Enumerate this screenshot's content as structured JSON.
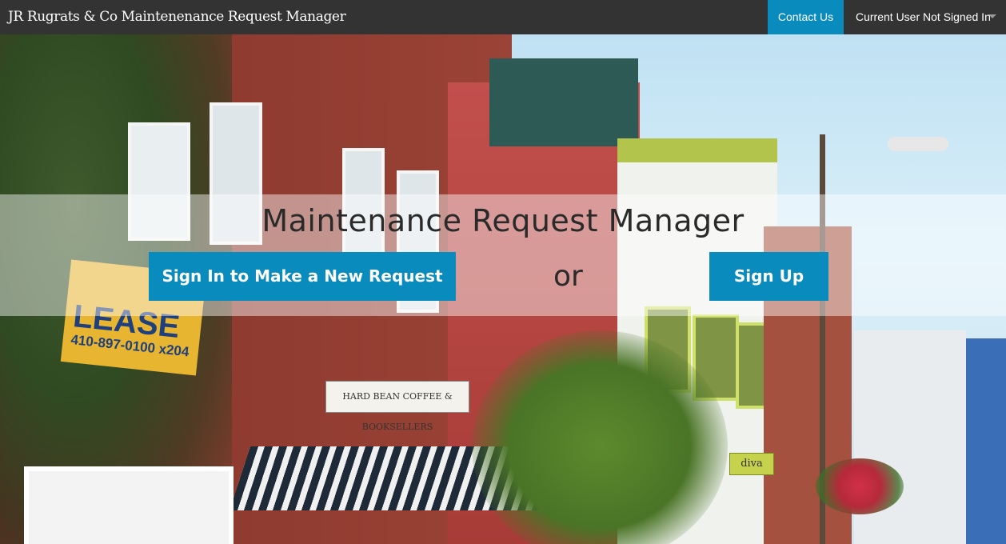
{
  "navbar": {
    "brand": "JR Rugrats & Co Maintenenance Request Manager",
    "contact_label": "Contact Us",
    "user_label": "Current User Not Signed In"
  },
  "hero": {
    "title": "Maintenance Request Manager",
    "signin_label": "Sign In to Make a New Request",
    "or_label": "or",
    "signup_label": "Sign Up"
  },
  "background_photo": {
    "lease_sign_text": "LEASE",
    "lease_phone": "410-897-0100 x204",
    "shop_sign": "HARD BEAN COFFEE & BOOKSELLERS",
    "shop2_sign": "diva"
  },
  "colors": {
    "navbar": "#333333",
    "accent": "#0a8bbd",
    "brick": "#8e3a2f",
    "sky": "#cfe7f2"
  }
}
